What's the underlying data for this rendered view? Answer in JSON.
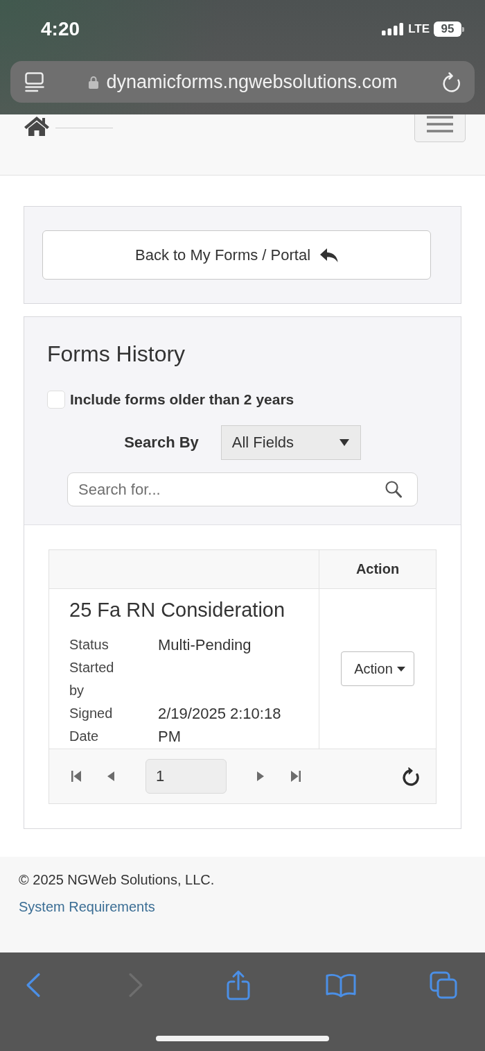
{
  "status_bar": {
    "time": "4:20",
    "network": "LTE",
    "battery": "95"
  },
  "address_bar": {
    "url": "dynamicforms.ngwebsolutions.com"
  },
  "back_panel": {
    "button": "Back to My Forms / Portal"
  },
  "forms_history": {
    "title": "Forms History",
    "include_older": {
      "label": "Include forms older than 2 years",
      "checked": false
    },
    "search_by": {
      "label": "Search By",
      "value": "All Fields"
    },
    "search": {
      "placeholder": "Search for..."
    },
    "table": {
      "header": {
        "column_2": "Action"
      },
      "rows": [
        {
          "title": "25 Fa RN Consideration",
          "fields": [
            {
              "label": "Status",
              "value": "Multi-Pending"
            },
            {
              "label": "Started by"
            },
            {
              "label": "Signed Date",
              "value": "2/19/2025 2:10:18 PM"
            }
          ],
          "action": "Action"
        }
      ],
      "pager": {
        "page": "1"
      }
    }
  },
  "footer": {
    "copyright": "© 2025 NGWeb Solutions, LLC.",
    "link": "System Requirements"
  },
  "toolbar": {
    "items": [
      {
        "kind": "back",
        "disabled": false
      },
      {
        "kind": "forward",
        "disabled": true
      },
      {
        "kind": "share",
        "disabled": false
      },
      {
        "kind": "bookmarks",
        "disabled": false
      },
      {
        "kind": "tabs",
        "disabled": false
      }
    ]
  }
}
